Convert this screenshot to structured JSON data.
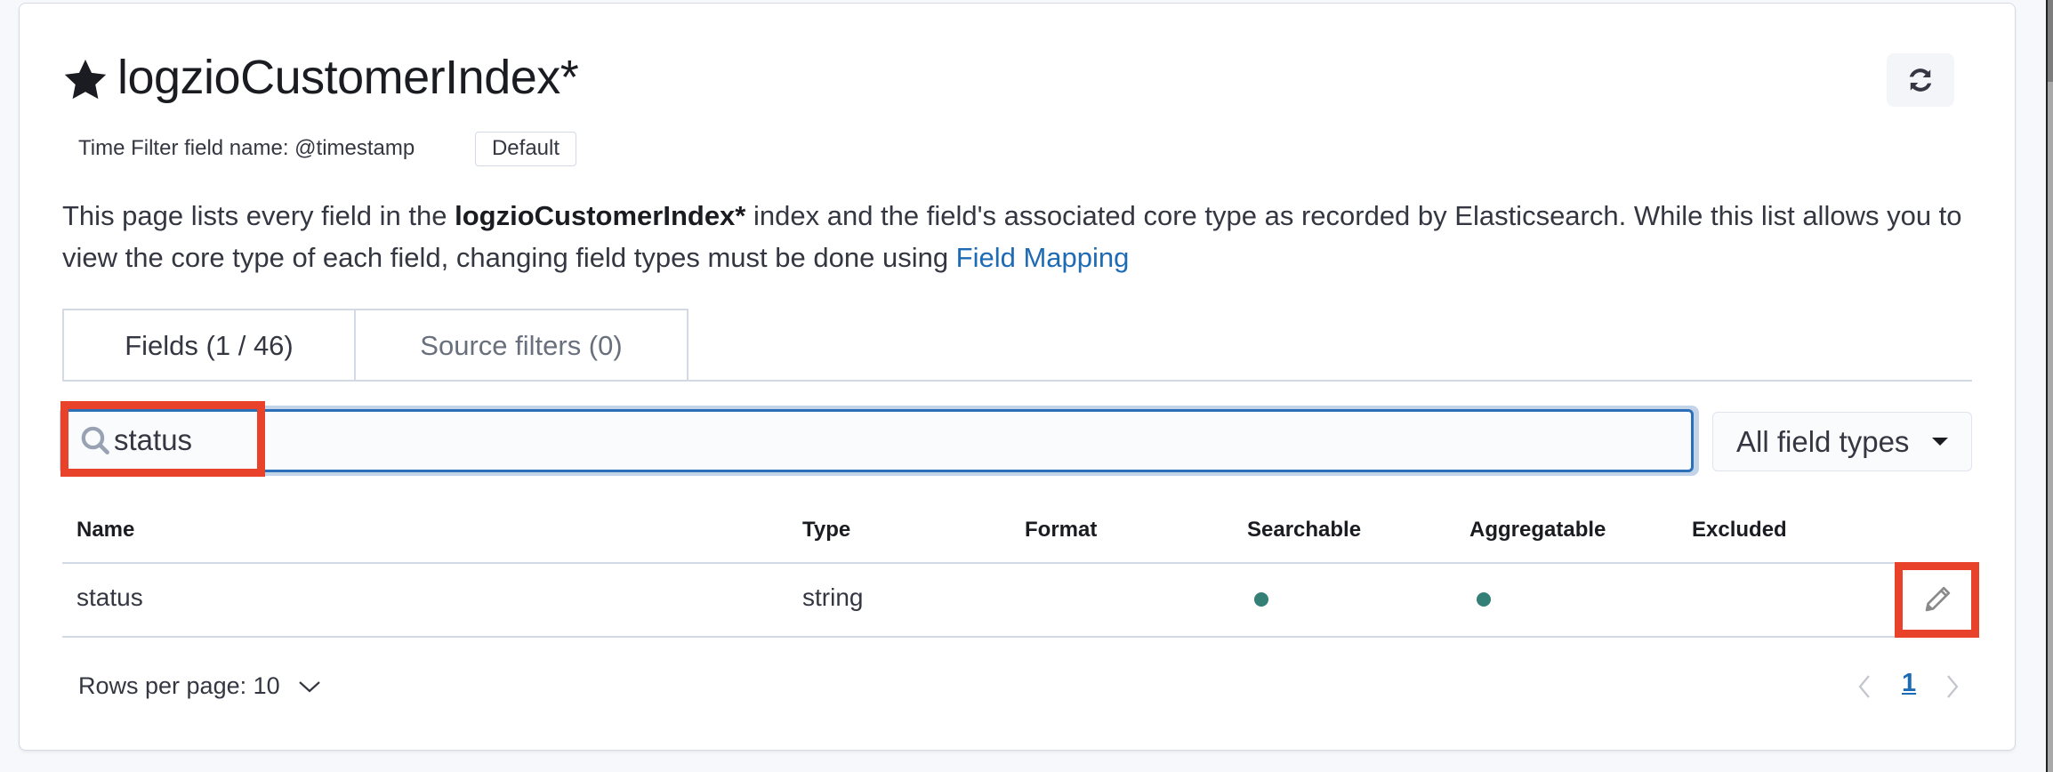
{
  "header": {
    "title": "logzioCustomerIndex*",
    "star_icon": "star-icon",
    "refresh_icon": "refresh-icon",
    "time_filter": "Time Filter field name: @timestamp",
    "default_badge": "Default"
  },
  "description": {
    "part1": "This page lists every field in the ",
    "bold": "logzioCustomerIndex*",
    "part2": " index and the field's associated core type as recorded by Elasticsearch. While this list allows you to view the core type of each field, changing field types must be done using ",
    "link": "Field Mapping"
  },
  "tabs": [
    {
      "label": "Fields (1 / 46)",
      "active": true
    },
    {
      "label": "Source filters (0)",
      "active": false
    }
  ],
  "search": {
    "value": "status",
    "icon": "search-icon"
  },
  "filter_select": {
    "selected": "All field types"
  },
  "table": {
    "columns": [
      "Name",
      "Type",
      "Format",
      "Searchable",
      "Aggregatable",
      "Excluded"
    ],
    "rows": [
      {
        "name": "status",
        "type": "string",
        "format": "",
        "searchable": true,
        "aggregatable": true,
        "excluded": false
      }
    ]
  },
  "pagination": {
    "rows_per_page": "Rows per page: 10",
    "current_page": "1"
  },
  "colors": {
    "accent": "#1e6bb5",
    "indicator": "#347f76",
    "highlight": "#e8432a"
  }
}
